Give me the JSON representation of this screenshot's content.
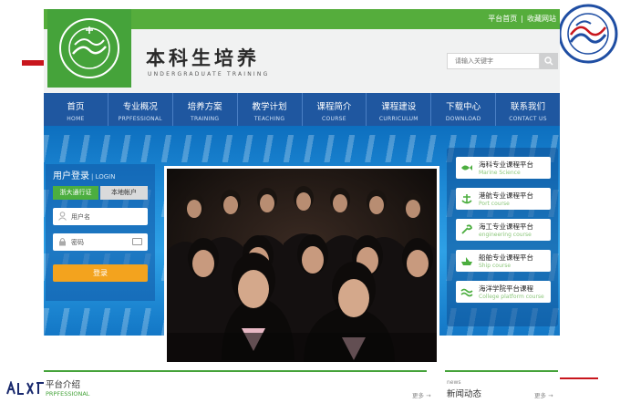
{
  "topbar": {
    "home_label": "平台首页",
    "separator": "|",
    "favorite_label": "收藏网站"
  },
  "header": {
    "title_cn": "本科生培养",
    "title_en": "UNDERGRADUATE TRAINING"
  },
  "search": {
    "placeholder": "请输入关键字"
  },
  "nav": {
    "items": [
      {
        "cn": "首页",
        "en": "HOME"
      },
      {
        "cn": "专业概况",
        "en": "PRPFESSIONAL"
      },
      {
        "cn": "培养方案",
        "en": "TRAINING"
      },
      {
        "cn": "教学计划",
        "en": "TEACHING"
      },
      {
        "cn": "课程简介",
        "en": "COURSE"
      },
      {
        "cn": "课程建设",
        "en": "CURRICULUM"
      },
      {
        "cn": "下载中心",
        "en": "DOWNLOAD"
      },
      {
        "cn": "联系我们",
        "en": "CONTACT US"
      }
    ]
  },
  "login": {
    "title": "用户登录",
    "title_en": "| LOGIN",
    "tab_zju": "浙大通行证",
    "tab_local": "本地帐户",
    "username_placeholder": "用户名",
    "password_placeholder": "密码",
    "submit_label": "登录"
  },
  "platforms": {
    "items": [
      {
        "cn": "海科专业课程平台",
        "en": "Marine Science",
        "icon": "fish-icon"
      },
      {
        "cn": "港航专业课程平台",
        "en": "Port course",
        "icon": "anchor-icon"
      },
      {
        "cn": "海工专业课程平台",
        "en": "engineering course",
        "icon": "wrench-icon"
      },
      {
        "cn": "船舶专业课程平台",
        "en": "Ship course",
        "icon": "ship-icon"
      },
      {
        "cn": "海洋学院平台课程",
        "en": "College platform course",
        "icon": "wave-icon"
      }
    ]
  },
  "sections": {
    "platform_intro": {
      "cn": "平台介绍",
      "en": "PRPFESSIONAL",
      "more": "更多 →"
    },
    "news": {
      "small": "news",
      "cn": "新闻动态",
      "more": "更多 →"
    }
  },
  "colors": {
    "brand_green": "#45a33a",
    "nav_blue": "#1f57a0",
    "login_orange": "#f3a31e",
    "accent_red": "#c8161d"
  }
}
